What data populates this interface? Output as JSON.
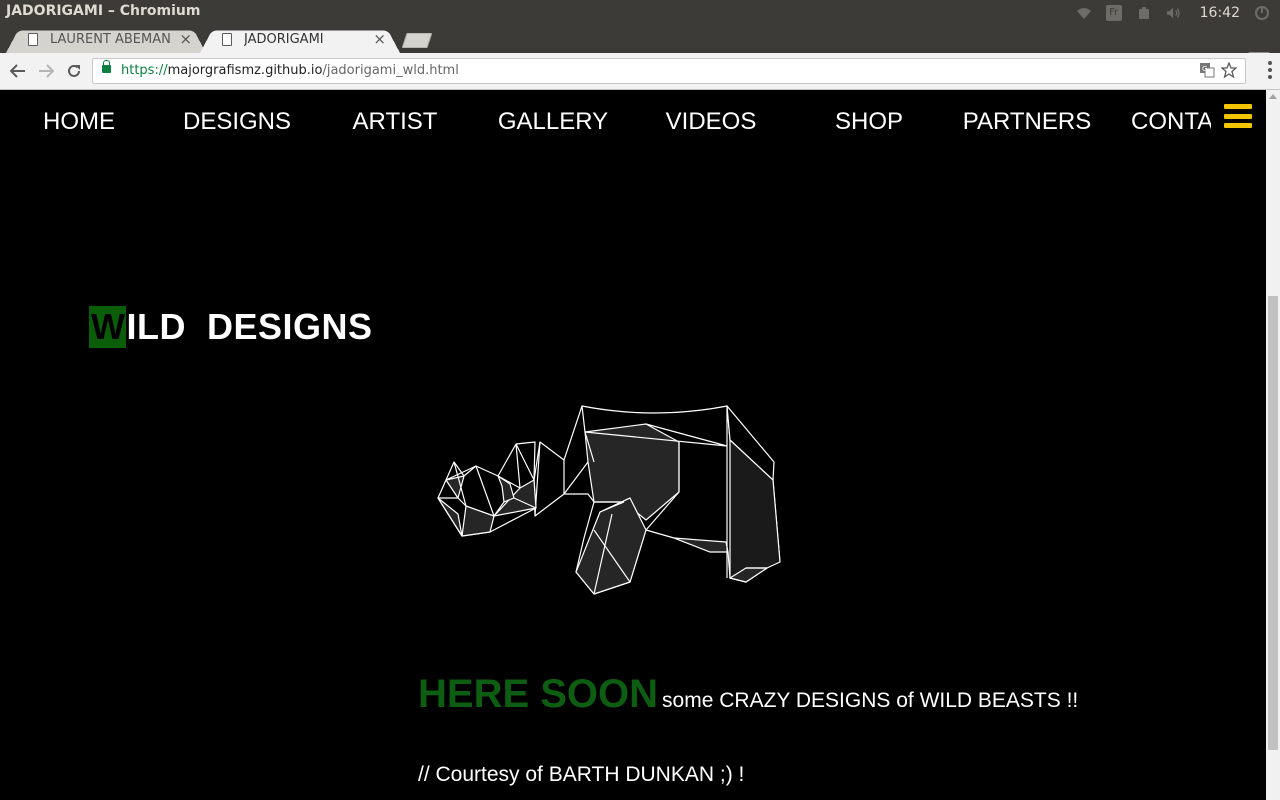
{
  "window": {
    "title": "JADORIGAMI – Chromium",
    "clock": "16:42",
    "tray_icons": [
      "wifi-icon",
      "keyboard-layout-icon",
      "battery-icon",
      "volume-icon",
      "system-settings-icon"
    ],
    "keyboard_layout_label": "Fr"
  },
  "tabs": [
    {
      "label": "LAURENT ABEMAN",
      "active": false,
      "close": "×"
    },
    {
      "label": "JADORIGAMI",
      "active": true,
      "close": "×"
    }
  ],
  "toolbar": {
    "url_scheme": "https://",
    "url_host": "majorgrafismz.github.io",
    "url_path": "/jadorigami_wld.html"
  },
  "site": {
    "nav": [
      "HOME",
      "DESIGNS",
      "ARTIST",
      "GALLERY",
      "VIDEOS",
      "SHOP",
      "PARTNERS",
      "CONTA"
    ],
    "hamburger_color": "#f5c400",
    "title_first_letter": "W",
    "title_rest": "ILD  DESIGNS",
    "title_highlight_color": "#0a5e0a",
    "soon_heading": "HERE SOON",
    "soon_text": "some CRAZY DESIGNS of WILD BEASTS !!",
    "soon_color": "#0d5e12",
    "courtesy": "// Courtesy of BARTH DUNKAN ;) !"
  }
}
